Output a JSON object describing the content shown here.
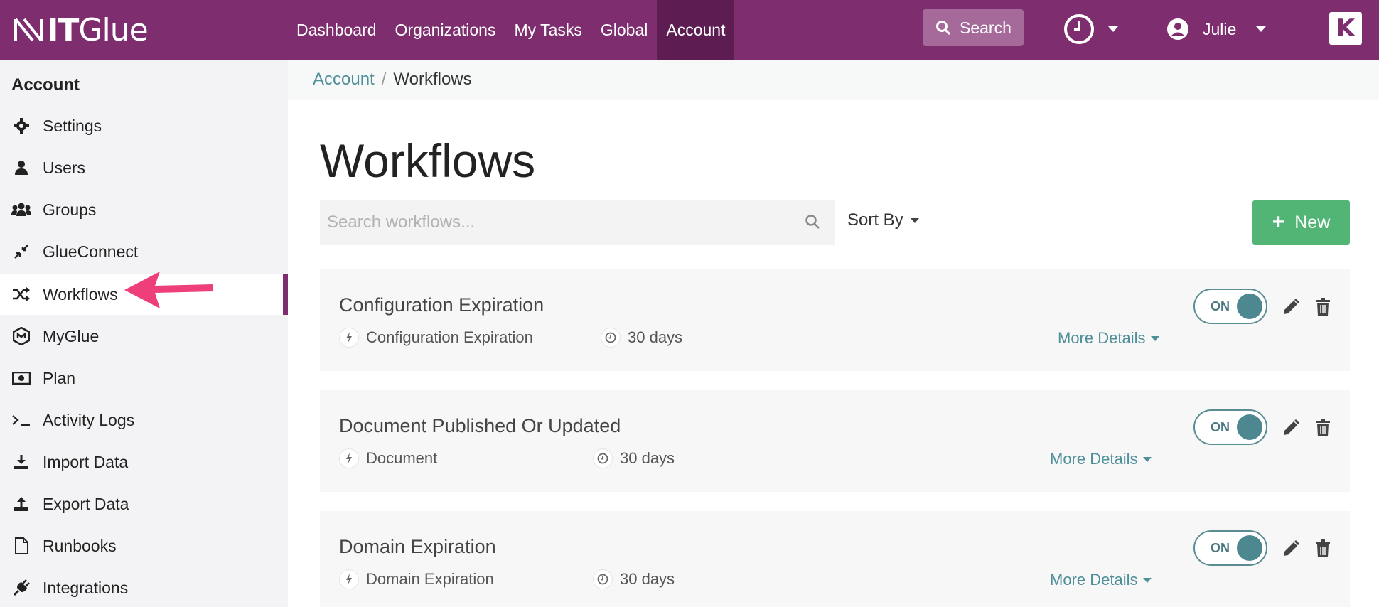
{
  "brand": {
    "logo_text_bold": "IT",
    "logo_text_light": "Glue",
    "primary_color": "#7e2d6e",
    "accent_teal": "#4f8f99",
    "new_green": "#52b475"
  },
  "nav": {
    "items": [
      "Dashboard",
      "Organizations",
      "My Tasks",
      "Global",
      "Account"
    ],
    "active": "Account",
    "search_label": "Search",
    "user_name": "Julie",
    "badge_letter": "K"
  },
  "sidebar": {
    "title": "Account",
    "items": [
      {
        "label": "Settings",
        "icon": "gear-icon"
      },
      {
        "label": "Users",
        "icon": "user-icon"
      },
      {
        "label": "Groups",
        "icon": "users-group-icon"
      },
      {
        "label": "GlueConnect",
        "icon": "compress-arrows-icon"
      },
      {
        "label": "Workflows",
        "icon": "shuffle-icon"
      },
      {
        "label": "MyGlue",
        "icon": "myglue-icon"
      },
      {
        "label": "Plan",
        "icon": "money-bill-icon"
      },
      {
        "label": "Activity Logs",
        "icon": "terminal-icon"
      },
      {
        "label": "Import Data",
        "icon": "download-icon"
      },
      {
        "label": "Export Data",
        "icon": "upload-icon"
      },
      {
        "label": "Runbooks",
        "icon": "file-icon"
      },
      {
        "label": "Integrations",
        "icon": "plug-icon"
      }
    ],
    "active": "Workflows"
  },
  "breadcrumb": {
    "parent": "Account",
    "separator": "/",
    "current": "Workflows"
  },
  "main": {
    "title": "Workflows",
    "search_placeholder": "Search workflows...",
    "sort_label": "Sort By",
    "new_label": "New"
  },
  "workflows": [
    {
      "title": "Configuration Expiration",
      "trigger": "Configuration Expiration",
      "duration": "30 days",
      "more": "More Details",
      "toggle": "ON"
    },
    {
      "title": "Document Published Or Updated",
      "trigger": "Document",
      "duration": "30 days",
      "more": "More Details",
      "toggle": "ON"
    },
    {
      "title": "Domain Expiration",
      "trigger": "Domain Expiration",
      "duration": "30 days",
      "more": "More Details",
      "toggle": "ON"
    }
  ]
}
